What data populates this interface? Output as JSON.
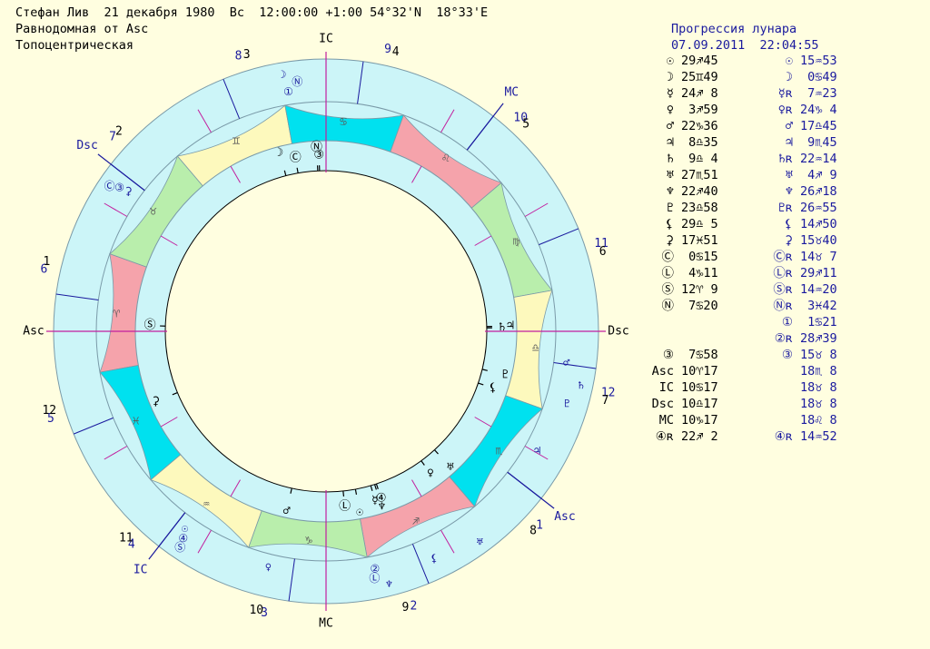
{
  "header": {
    "line1": "Стефан Лив  21 декабря 1980  Вс  12:00:00 +1:00 54°32'N  18°33'E",
    "line2": "Равнодомная от Asc",
    "line3": "Топоцентрическая"
  },
  "progression": {
    "title": "Прогрессия лунара",
    "datetime": "07.09.2011  22:04:55"
  },
  "colors": {
    "background": "#fffee0",
    "ring": "#ccf5f8",
    "fire": "#f5a3ab",
    "earth": "#b9eeac",
    "air": "#fdf9bd",
    "water": "#00e1ef",
    "axis": "#c21f9e",
    "house_line": "#1a1a9e",
    "progressed_text": "#1a1a9e"
  },
  "natal_positions": [
    {
      "glyph": "☉",
      "text": "29♐45"
    },
    {
      "glyph": "☽",
      "text": "25♊49"
    },
    {
      "glyph": "☿",
      "text": "24♐ 8"
    },
    {
      "glyph": "♀",
      "text": " 3♐59"
    },
    {
      "glyph": "♂",
      "text": "22♑36"
    },
    {
      "glyph": "♃",
      "text": " 8♎35"
    },
    {
      "glyph": "♄",
      "text": " 9♎ 4"
    },
    {
      "glyph": "♅",
      "text": "27♏51"
    },
    {
      "glyph": "♆",
      "text": "22♐40"
    },
    {
      "glyph": "♇",
      "text": "23♎58"
    },
    {
      "glyph": "⚸",
      "text": "29♎ 5"
    },
    {
      "glyph": "⚳",
      "text": "17♓51"
    },
    {
      "glyph": "Ⓒ",
      "text": " 0♋15"
    },
    {
      "glyph": "Ⓛ",
      "text": " 4♑11"
    },
    {
      "glyph": "Ⓢ",
      "text": "12♈ 9"
    },
    {
      "glyph": "Ⓝ",
      "text": " 7♋20"
    },
    {
      "glyph": "",
      "text": ""
    },
    {
      "glyph": "",
      "text": ""
    },
    {
      "glyph": "③",
      "text": " 7♋58"
    },
    {
      "glyph": "Asc",
      "text": "10♈17"
    },
    {
      "glyph": "IC",
      "text": "10♋17"
    },
    {
      "glyph": "Dsc",
      "text": "10♎17"
    },
    {
      "glyph": "MC",
      "text": "10♑17"
    },
    {
      "glyph": "④ʀ",
      "text": "22♐ 2"
    }
  ],
  "progressed_positions": [
    {
      "glyph": "☉",
      "text": "15♒53"
    },
    {
      "glyph": "☽",
      "text": " 0♋49"
    },
    {
      "glyph": "☿ʀ",
      "text": " 7♒23"
    },
    {
      "glyph": "♀ʀ",
      "text": "24♑ 4"
    },
    {
      "glyph": "♂",
      "text": "17♎45"
    },
    {
      "glyph": "♃",
      "text": " 9♏45"
    },
    {
      "glyph": "♄ʀ",
      "text": "22♒14"
    },
    {
      "glyph": "♅",
      "text": " 4♐ 9"
    },
    {
      "glyph": "♆",
      "text": "26♐18"
    },
    {
      "glyph": "♇ʀ",
      "text": "26♒55"
    },
    {
      "glyph": "⚸",
      "text": "14♐50"
    },
    {
      "glyph": "⚳",
      "text": "15♉40"
    },
    {
      "glyph": "Ⓒʀ",
      "text": "14♉ 7"
    },
    {
      "glyph": "Ⓛʀ",
      "text": "29♐11"
    },
    {
      "glyph": "Ⓢʀ",
      "text": "14♒20"
    },
    {
      "glyph": "Ⓝʀ",
      "text": " 3♓42"
    },
    {
      "glyph": "①",
      "text": " 1♋21"
    },
    {
      "glyph": "②ʀ",
      "text": "28♐39"
    },
    {
      "glyph": "③",
      "text": "15♉ 8"
    },
    {
      "glyph": "",
      "text": "18♏ 8"
    },
    {
      "glyph": "",
      "text": "18♉ 8"
    },
    {
      "glyph": "",
      "text": "18♉ 8"
    },
    {
      "glyph": "",
      "text": "18♌ 8"
    },
    {
      "glyph": "④ʀ",
      "text": "14♒52"
    }
  ],
  "wheel": {
    "sign_glyphs": [
      "♈",
      "♉",
      "♊",
      "♋",
      "♌",
      "♍",
      "♎",
      "♏",
      "♐",
      "♑",
      "♒",
      "♓"
    ],
    "asc_degree": 10.2833,
    "natal_houses": [
      {
        "label": "1",
        "degree": 10.2833
      },
      {
        "label": "2",
        "degree": 40.2833
      },
      {
        "label": "3",
        "degree": 70.2833
      },
      {
        "label": "4",
        "degree": 100.2833
      },
      {
        "label": "5",
        "degree": 130.2833
      },
      {
        "label": "6",
        "degree": 160.2833
      },
      {
        "label": "7",
        "degree": 190.2833
      },
      {
        "label": "8",
        "degree": 220.2833
      },
      {
        "label": "9",
        "degree": 250.2833
      },
      {
        "label": "10",
        "degree": 280.2833
      },
      {
        "label": "11",
        "degree": 310.2833
      },
      {
        "label": "12",
        "degree": 340.2833
      }
    ],
    "progressed_houses": [
      {
        "label": "1",
        "degree": 228.1333
      },
      {
        "label": "2",
        "degree": 258.1333
      },
      {
        "label": "3",
        "degree": 288.1333
      },
      {
        "label": "4",
        "degree": 318.1333
      },
      {
        "label": "5",
        "degree": 348.1333
      },
      {
        "label": "6",
        "degree": 18.1333
      },
      {
        "label": "7",
        "degree": 48.1333
      },
      {
        "label": "8",
        "degree": 78.1333
      },
      {
        "label": "9",
        "degree": 108.1333
      },
      {
        "label": "10",
        "degree": 138.1333
      },
      {
        "label": "11",
        "degree": 168.1333
      },
      {
        "label": "12",
        "degree": 198.1333
      }
    ],
    "natal_axes": [
      {
        "label": "Asc",
        "degree": 10.2833
      },
      {
        "label": "Dsc",
        "degree": 190.2833
      },
      {
        "label": "MC",
        "degree": 280.2833
      },
      {
        "label": "IC",
        "degree": 100.2833
      }
    ],
    "progressed_axes": [
      {
        "label": "Asc",
        "degree": 228.1333
      },
      {
        "label": "Dsc",
        "degree": 48.1333
      },
      {
        "label": "MC",
        "degree": 138.1333
      },
      {
        "label": "IC",
        "degree": 318.1333
      }
    ],
    "natal_planets": [
      {
        "glyph": "Ⓛ",
        "degree": 274.18
      },
      {
        "glyph": "☉",
        "degree": 269.75
      },
      {
        "glyph": "☿",
        "degree": 264.13
      },
      {
        "glyph": "♆",
        "degree": 262.67
      },
      {
        "glyph": "④",
        "degree": 262.03
      },
      {
        "glyph": "♂",
        "degree": 292.6
      },
      {
        "glyph": "♀",
        "degree": 243.98
      },
      {
        "glyph": "♅",
        "degree": 237.85
      },
      {
        "glyph": "⚸",
        "degree": 209.08
      },
      {
        "glyph": "♇",
        "degree": 203.97
      },
      {
        "glyph": "♄",
        "degree": 189.07
      },
      {
        "glyph": "♃",
        "degree": 188.58
      },
      {
        "glyph": "③",
        "degree": 97.97
      },
      {
        "glyph": "Ⓝ",
        "degree": 97.33
      },
      {
        "glyph": "Ⓒ",
        "degree": 90.25
      },
      {
        "glyph": "☽",
        "degree": 85.82
      },
      {
        "glyph": "Ⓢ",
        "degree": 12.15
      },
      {
        "glyph": "⚳",
        "degree": 347.85
      }
    ],
    "progressed_planets": [
      {
        "glyph": "♀",
        "degree": 294.07
      },
      {
        "glyph": "Ⓛ",
        "degree": 269.18
      },
      {
        "glyph": "♆",
        "degree": 266.3
      },
      {
        "glyph": "②",
        "degree": 268.65
      },
      {
        "glyph": "⚸",
        "degree": 254.83
      },
      {
        "glyph": "♅",
        "degree": 244.15
      },
      {
        "glyph": "♃",
        "degree": 219.75
      },
      {
        "glyph": "♇",
        "degree": 206.92
      },
      {
        "glyph": "♄",
        "degree": 202.23
      },
      {
        "glyph": "♂",
        "degree": 197.75
      },
      {
        "glyph": "Ⓝ",
        "degree": 93.7
      },
      {
        "glyph": "☽",
        "degree": 90.82
      },
      {
        "glyph": "①",
        "degree": 91.35
      },
      {
        "glyph": "③",
        "degree": 45.13
      },
      {
        "glyph": "Ⓒ",
        "degree": 44.12
      },
      {
        "glyph": "⚳",
        "degree": 45.67
      },
      {
        "glyph": "④",
        "degree": 314.87
      },
      {
        "glyph": "Ⓢ",
        "degree": 314.33
      },
      {
        "glyph": "☉",
        "degree": 315.88
      }
    ]
  }
}
